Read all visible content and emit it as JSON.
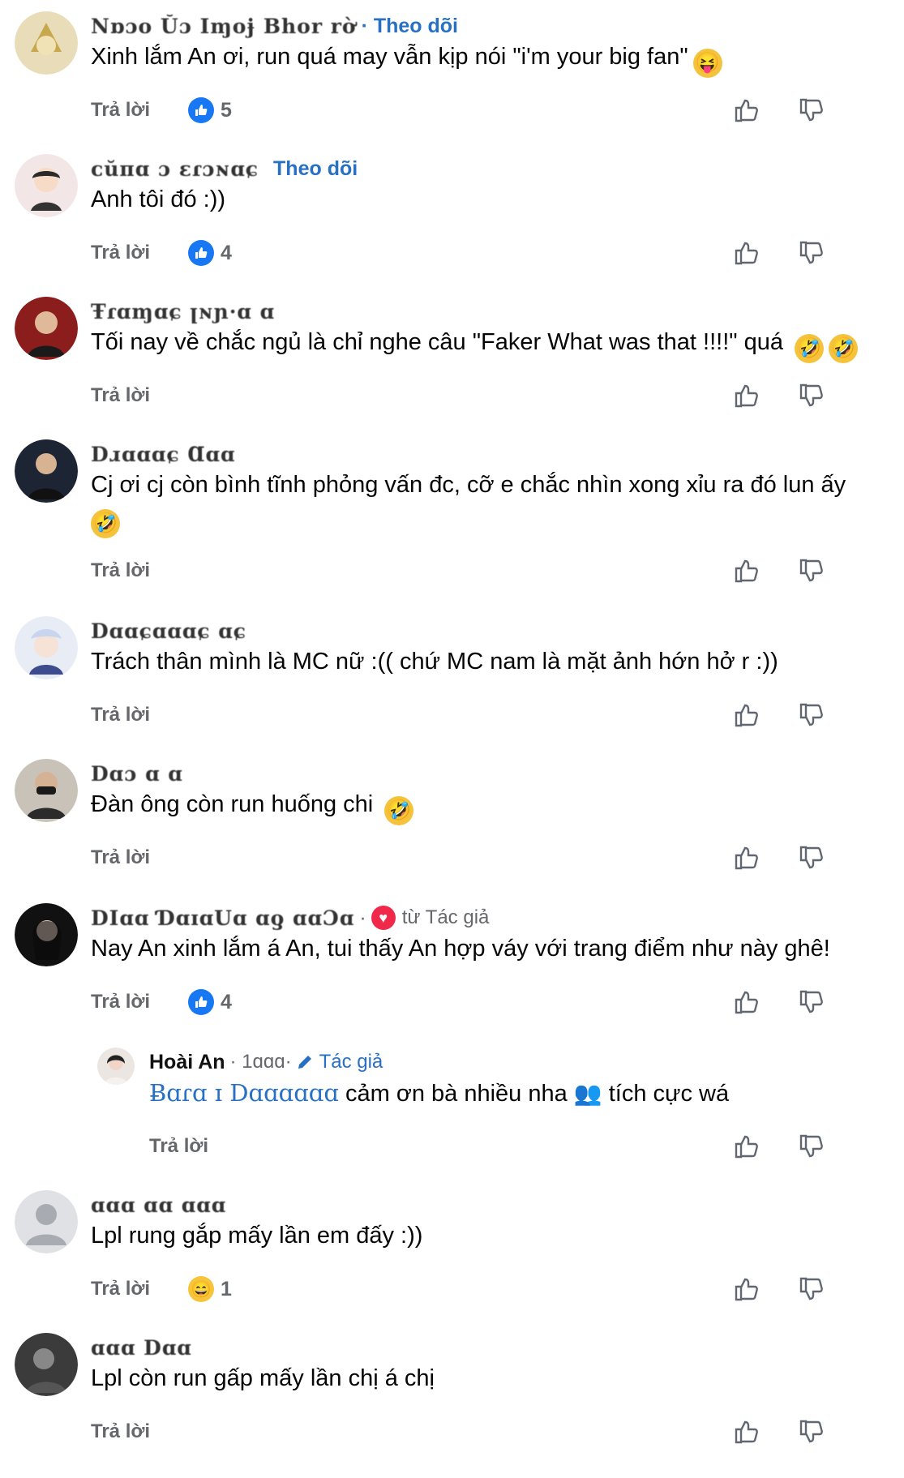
{
  "labels": {
    "reply": "Trả lời",
    "follow": "Theo dõi"
  },
  "comments": [
    {
      "name": "Nɒɔo Ŭɔ Iɱoɉ Bhor rờ",
      "meta": "· Theo dõi",
      "text": "Xinh lắm An ơi, run quá may vẫn kịp nói \"i'm your big fan\"",
      "emoji": "😝",
      "likes": "5"
    },
    {
      "name": "ᴄŭᴨɑ ɔ ɛɾɔɴɑɕ",
      "follow": "Theo dõi",
      "text": "Anh tôi đó :))",
      "likes": "4"
    },
    {
      "name": "Ŧɾɑɱɑɕ ꞁɴɲ·ɑ ɑ",
      "text": "Tối nay về chắc ngủ là chỉ nghe câu \"Faker What was that !!!!\" quá",
      "emoji": "🤣🤣"
    },
    {
      "name": "Dɹɑɑɑɕ Ɑɑɑ",
      "text": "Cj ơi cj còn bình tĩnh phỏng vấn đc, cỡ e chắc nhìn xong xỉu ra đó lun ấy",
      "emoji": "🤣"
    },
    {
      "name": "Dɑɑɕɑɑɑɕ ɑɕ",
      "text": "Trách thân mình là MC nữ :(( chứ MC nam là mặt ảnh hớn hở r :))"
    },
    {
      "name": "Dɑɔ ɑ ɑ",
      "text": "Đàn ông còn run huống chi",
      "emoji": "🤣"
    },
    {
      "name": "DIɑɑ ƊɑɪɑUɑ ɑƍ ɑɑƆɑ",
      "fan_label": "từ Tác giả",
      "text": "Nay An xinh lắm á An, tui thấy An hợp váy với trang điểm như này ghê!",
      "likes": "4"
    }
  ],
  "reply": {
    "name": "Hoài An",
    "meta": "· 1ɑɑɑ·",
    "author_label": "Tác giả",
    "mention": "Ƀɑɾɑ ɪ Dɑɑɑɑɑɑ",
    "text_a": "cảm ơn bà nhiều nha",
    "emoji": "👥",
    "text_b": "tích cực wá"
  },
  "comments2": [
    {
      "name": "ɑɑɑ ɑɑ ɑɑɑ",
      "text": "Lpl rung gắp mấy lần em đấy :))",
      "reaction_count": "1"
    },
    {
      "name": "ɑɑɑ Dɑɑ",
      "text": "Lpl còn run gấp mấy lần chị á chị"
    }
  ],
  "colors": {
    "link": "#2770c4",
    "muted": "#65676b",
    "like": "#1877f2"
  }
}
